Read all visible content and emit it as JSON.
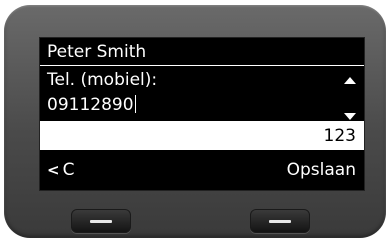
{
  "contact": {
    "name": "Peter Smith"
  },
  "field": {
    "label": "Tel. (mobiel):",
    "value": "09112890"
  },
  "input_mode": "123",
  "softkeys": {
    "left_label": "C",
    "right_label": "Opslaan"
  },
  "icons": {
    "back": "chevron-left-icon",
    "scroll_up": "triangle-up-icon",
    "scroll_down": "triangle-down-icon"
  }
}
